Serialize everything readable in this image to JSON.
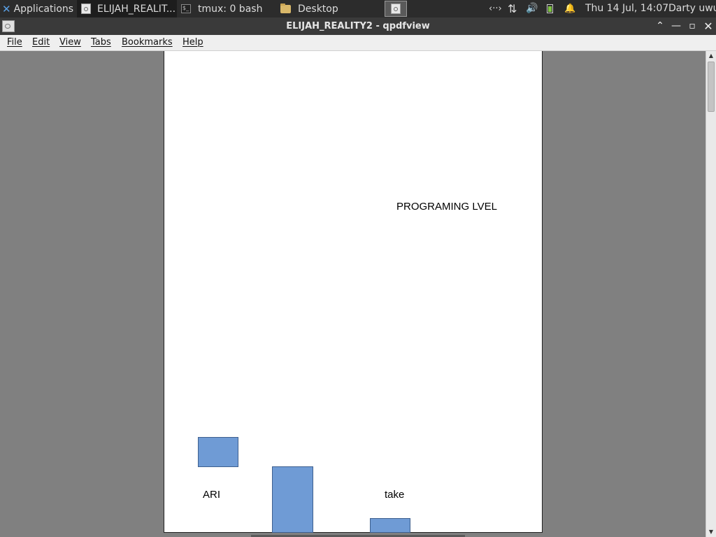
{
  "panel": {
    "applications_label": "Applications",
    "tasks": [
      {
        "label": "ELIJAH_REALIT..."
      },
      {
        "label": "tmux: 0 bash"
      },
      {
        "label": "Desktop"
      }
    ],
    "tray": {
      "network_icon": "‹··›",
      "transfer_icon": "⇅",
      "volume_icon": "🔊",
      "bell_icon": "🔔",
      "clock": "Thu 14 Jul, 14:07",
      "user": "Darty uwu"
    }
  },
  "window": {
    "title": "ELIJAH_REALITY2 - qpdfview",
    "buttons": {
      "shade": "⌃",
      "minimize": "—",
      "maximize": "▫",
      "close": "✕"
    }
  },
  "menubar": {
    "items": [
      "File",
      "Edit",
      "View",
      "Tabs",
      "Bookmarks",
      "Help"
    ]
  },
  "document": {
    "heading": "PROGRAMING LVEL",
    "labels": [
      "ARI",
      "take"
    ],
    "shape_color": "#6f9bd5"
  },
  "scrollbar": {
    "up_arrow": "▲",
    "down_arrow": "▼"
  }
}
